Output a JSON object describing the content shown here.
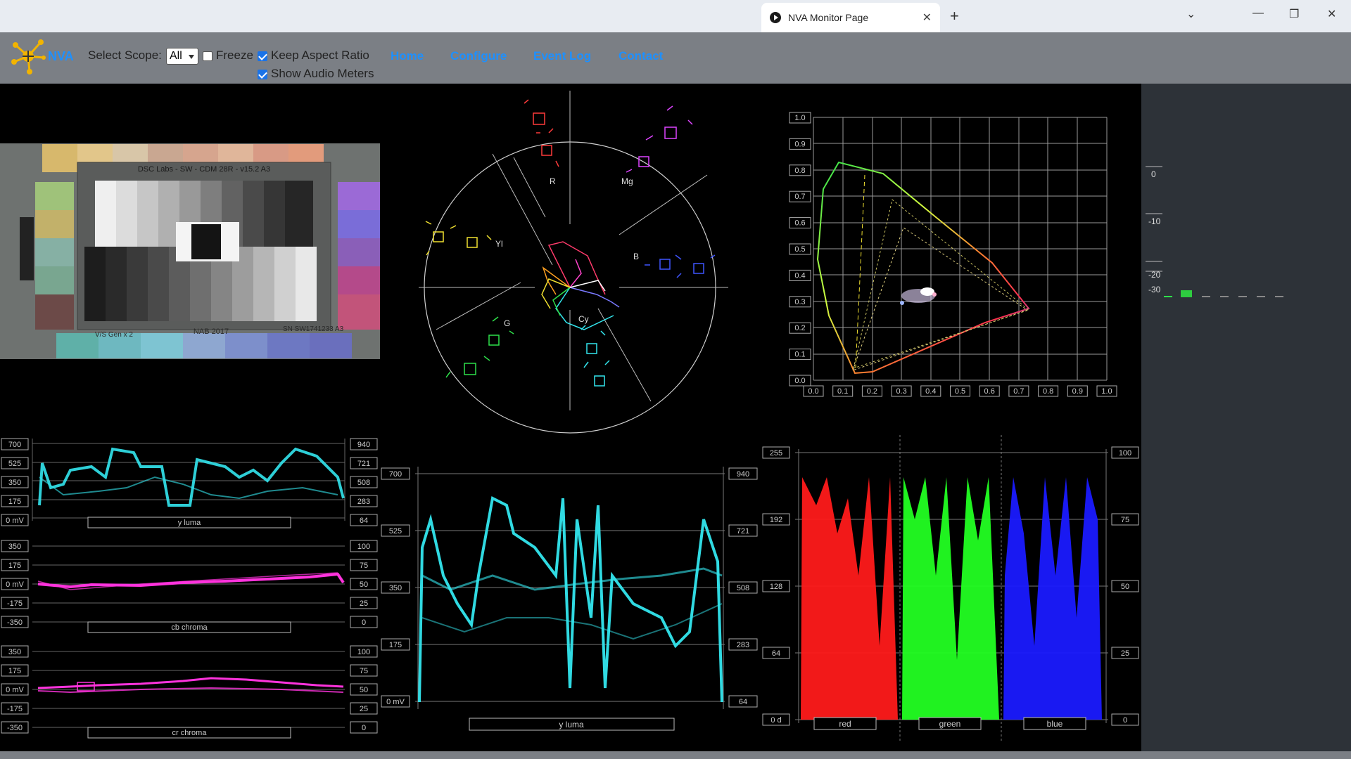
{
  "browser": {
    "tab_title": "NVA Monitor Page",
    "new_tab": "+",
    "close": "✕",
    "chevron": "⌄",
    "minimize": "—",
    "restore": "❐",
    "window_close": "✕"
  },
  "nav": {
    "logo_text": "NVA",
    "select_scope_label": "Select Scope:",
    "scope_value": "All",
    "freeze": {
      "label": "Freeze",
      "checked": false
    },
    "keep_aspect": {
      "label": "Keep Aspect Ratio",
      "checked": true
    },
    "audio_meters": {
      "label": "Show Audio Meters",
      "checked": true
    },
    "links": [
      "Home",
      "Configure",
      "Event Log",
      "Contact"
    ]
  },
  "colors": {
    "accent": "#1e90ff",
    "nav_bg": "#7b7f85",
    "cyan": "#33e6ee",
    "magenta": "#ff33dd"
  },
  "test_chart": {
    "title": "DSC Labs - SW - CDM 28R - v15.2 A3",
    "left_note": "V/S Gen x 2",
    "center_note": "NAB 2017",
    "right_note": "SN SW1741233 A3"
  },
  "vectorscope": {
    "labels": [
      "R",
      "Mg",
      "Yl",
      "B",
      "G",
      "Cy"
    ]
  },
  "cie": {
    "y_ticks": [
      "1.0",
      "0.9",
      "0.8",
      "0.7",
      "0.6",
      "0.5",
      "0.4",
      "0.3",
      "0.2",
      "0.1",
      "0.0"
    ],
    "x_ticks": [
      "0.0",
      "0.1",
      "0.2",
      "0.3",
      "0.4",
      "0.5",
      "0.6",
      "0.7",
      "0.8",
      "0.9",
      "1.0"
    ]
  },
  "audio": {
    "ticks": [
      "0",
      "-10",
      "-20",
      "-30"
    ]
  },
  "luma_small": {
    "left": [
      "700",
      "525",
      "350",
      "175",
      "0 mV"
    ],
    "right": [
      "940",
      "721",
      "508",
      "283",
      "64"
    ],
    "caption": "y luma"
  },
  "cb": {
    "left": [
      "350",
      "175",
      "0 mV",
      "-175",
      "-350"
    ],
    "right": [
      "100",
      "75",
      "50",
      "25",
      "0"
    ],
    "caption": "cb chroma"
  },
  "cr": {
    "left": [
      "350",
      "175",
      "0 mV",
      "-175",
      "-350"
    ],
    "right": [
      "100",
      "75",
      "50",
      "25",
      "0"
    ],
    "caption": "cr chroma"
  },
  "luma_big": {
    "left": [
      "700",
      "525",
      "350",
      "175",
      "0 mV"
    ],
    "right": [
      "940",
      "721",
      "508",
      "283",
      "64"
    ],
    "caption": "y luma"
  },
  "rgb": {
    "left": [
      "255",
      "192",
      "128",
      "64",
      "0 d"
    ],
    "right": [
      "100",
      "75",
      "50",
      "25",
      "0"
    ],
    "captions": [
      "red",
      "green",
      "blue"
    ]
  }
}
